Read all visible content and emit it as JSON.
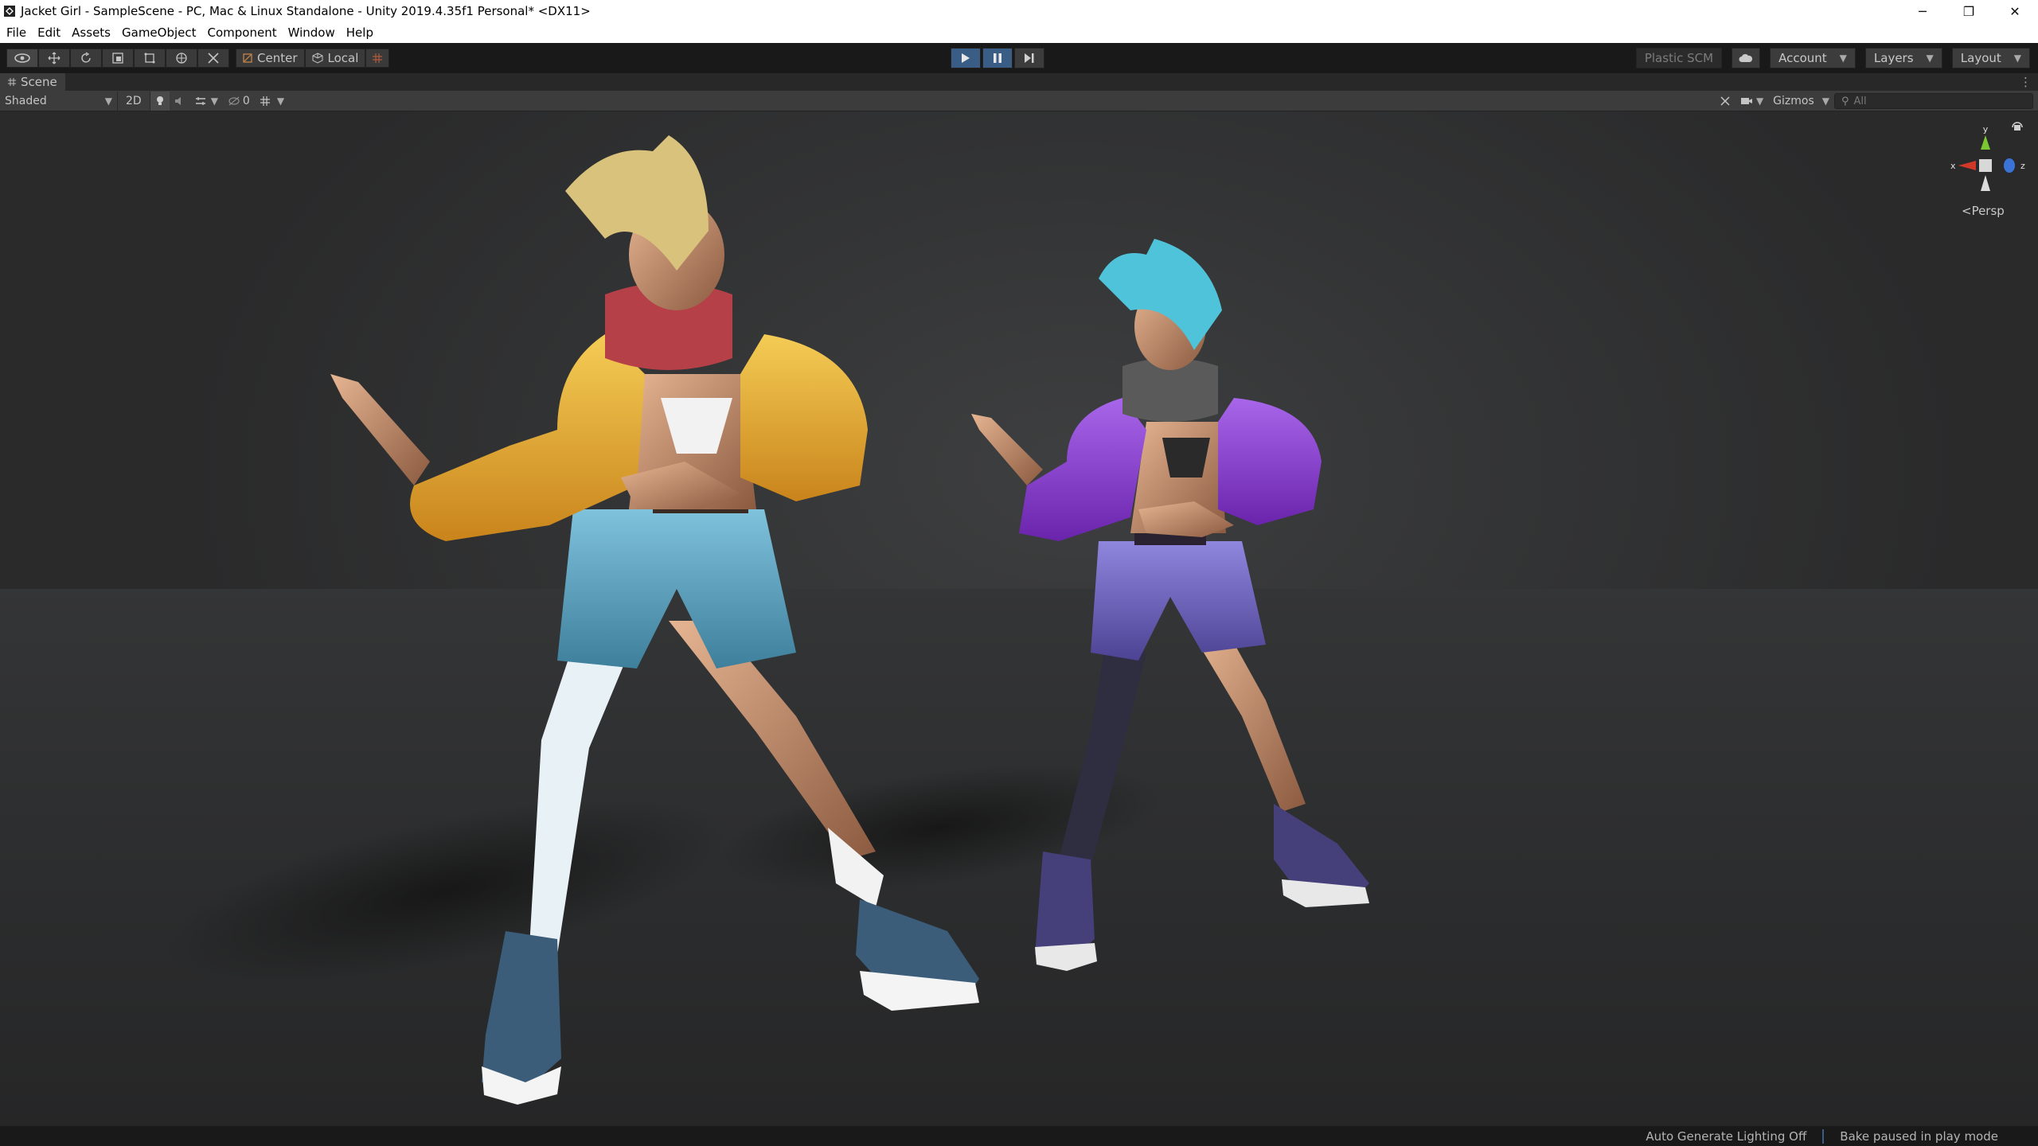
{
  "window": {
    "title": "Jacket Girl - SampleScene - PC, Mac & Linux Standalone - Unity 2019.4.35f1 Personal* <DX11>",
    "controls": {
      "minimize": "─",
      "restore": "❐",
      "close": "✕"
    }
  },
  "menubar": [
    "File",
    "Edit",
    "Assets",
    "GameObject",
    "Component",
    "Window",
    "Help"
  ],
  "toolbar": {
    "pivot_mode": "Center",
    "pivot_rotation": "Local",
    "plastic_scm": "Plastic SCM",
    "account": "Account",
    "layers": "Layers",
    "layout": "Layout"
  },
  "scene": {
    "tab_label": "Scene",
    "shading_mode": "Shaded",
    "mode_2d": "2D",
    "hidden_count": "0",
    "gizmos": "Gizmos",
    "search_placeholder": "All",
    "projection": "<Persp",
    "axes": {
      "x": "x",
      "y": "y",
      "z": "z"
    }
  },
  "status": {
    "lighting": "Auto Generate Lighting Off",
    "bake": "Bake paused in play mode"
  },
  "colors": {
    "accent_blue": "#3a5d86",
    "yellow_jacket": "#e8b233",
    "purple_jacket": "#8a3fd0",
    "teal_hair": "#4fc3d9",
    "blonde_hair": "#d9c27c"
  }
}
